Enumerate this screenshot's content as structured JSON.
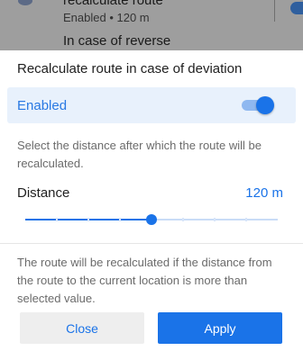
{
  "background_item": {
    "title": "recalculate route",
    "subtitle": "Enabled • 120 m",
    "next_title": "In case of reverse"
  },
  "dialog": {
    "title": "Recalculate route in case of deviation",
    "enabled_label": "Enabled",
    "enabled": true,
    "description": "Select the distance after which the route will be recalculated.",
    "distance_label": "Distance",
    "distance_value": "120 m",
    "slider": {
      "steps": 8,
      "selected_step": 4
    },
    "note": "The route will be recalculated if the distance from the route to the current location is more than selected value.",
    "close_label": "Close",
    "apply_label": "Apply"
  },
  "colors": {
    "accent": "#1a73e8",
    "enabled_row_bg": "#e8f1fc",
    "dim_overlay": "#9e9e9e"
  },
  "icons": {
    "enabled_switch": "toggle-switch-icon"
  }
}
